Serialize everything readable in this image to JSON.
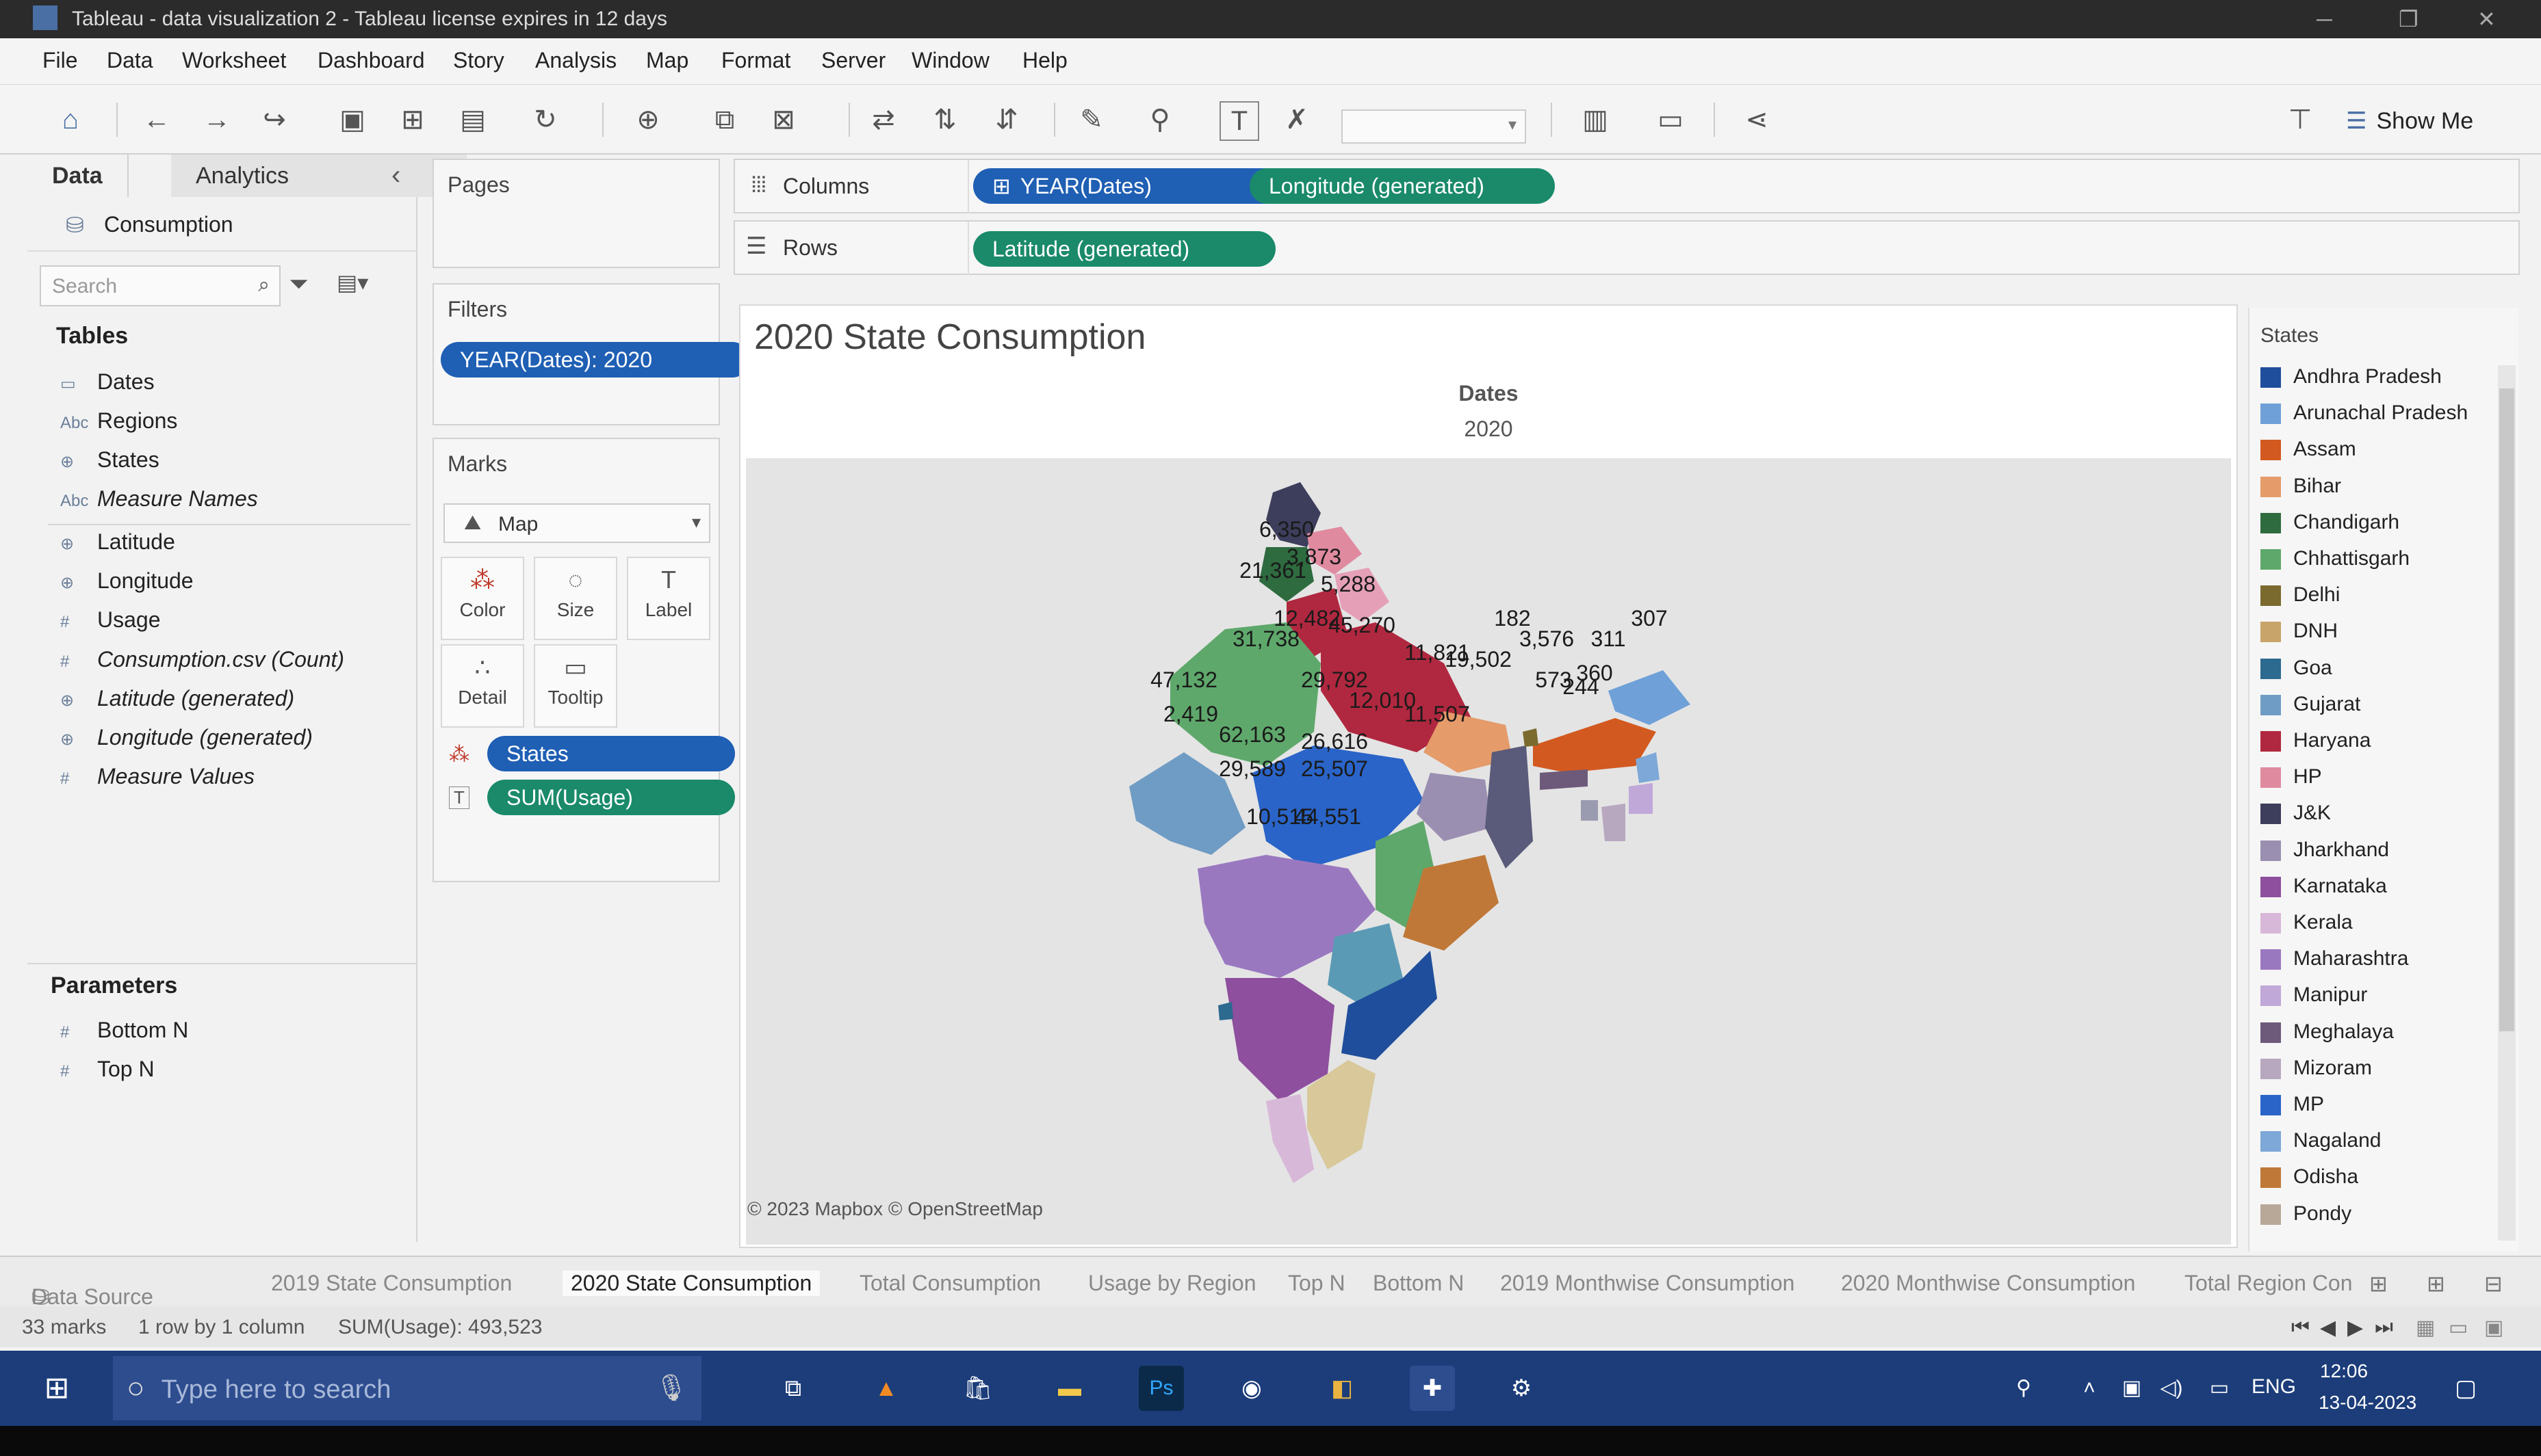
{
  "window": {
    "title": "Tableau - data visualization 2 - Tableau license expires in 12 days",
    "controls": {
      "minimize": "─",
      "restore": "❐",
      "close": "✕"
    }
  },
  "menu": [
    "File",
    "Data",
    "Worksheet",
    "Dashboard",
    "Story",
    "Analysis",
    "Map",
    "Format",
    "Server",
    "Window",
    "Help"
  ],
  "toolbar": {
    "show_me_label": "Show Me"
  },
  "left_panel": {
    "tabs": [
      "Data",
      "Analytics"
    ],
    "collapse_glyph": "‹",
    "datasource": "Consumption",
    "search_placeholder": "Search",
    "tables_heading": "Tables",
    "fields": [
      {
        "icon": "calendar-icon",
        "type": "▭",
        "label": "Dates",
        "italic": false
      },
      {
        "icon": "abc-icon",
        "type": "Abc",
        "label": "Regions",
        "italic": false
      },
      {
        "icon": "globe-icon",
        "type": "⊕",
        "label": "States",
        "italic": false
      },
      {
        "icon": "abc-icon",
        "type": "Abc",
        "label": "Measure Names",
        "italic": true
      },
      {
        "icon": "globe-icon",
        "type": "⊕",
        "label": "Latitude",
        "italic": false
      },
      {
        "icon": "globe-icon",
        "type": "⊕",
        "label": "Longitude",
        "italic": false
      },
      {
        "icon": "hash-icon",
        "type": "#",
        "label": "Usage",
        "italic": false
      },
      {
        "icon": "hash-icon",
        "type": "#",
        "label": "Consumption.csv (Count)",
        "italic": true
      },
      {
        "icon": "globe-icon",
        "type": "⊕",
        "label": "Latitude (generated)",
        "italic": true
      },
      {
        "icon": "globe-icon",
        "type": "⊕",
        "label": "Longitude (generated)",
        "italic": true
      },
      {
        "icon": "hash-icon",
        "type": "#",
        "label": "Measure Values",
        "italic": true
      }
    ],
    "parameters_heading": "Parameters",
    "parameters": [
      {
        "type": "#",
        "label": "Bottom N"
      },
      {
        "type": "#",
        "label": "Top N"
      }
    ]
  },
  "shelves": {
    "pages_label": "Pages",
    "filters_label": "Filters",
    "filter_pill": "YEAR(Dates): 2020",
    "marks_label": "Marks",
    "mark_type": "Map",
    "mark_buttons": [
      {
        "icon": "color-icon",
        "glyph": "⁂",
        "label": "Color"
      },
      {
        "icon": "size-icon",
        "glyph": "◌",
        "label": "Size"
      },
      {
        "icon": "label-icon",
        "glyph": "T",
        "label": "Label"
      },
      {
        "icon": "detail-icon",
        "glyph": "∴",
        "label": "Detail"
      },
      {
        "icon": "tooltip-icon",
        "glyph": "▭",
        "label": "Tooltip"
      }
    ],
    "mark_pills": [
      {
        "glyph": "⁂",
        "label": "States"
      },
      {
        "glyph": "T",
        "label": "SUM(Usage)"
      }
    ],
    "columns_label": "Columns",
    "columns_pills": [
      "YEAR(Dates)",
      "Longitude (generated)"
    ],
    "rows_label": "Rows",
    "rows_pills": [
      "Latitude (generated)"
    ]
  },
  "viz": {
    "title": "2020 State Consumption",
    "header_field": "Dates",
    "header_value": "2020",
    "attribution": "© 2023 Mapbox © OpenStreetMap",
    "map_labels": [
      {
        "text": "6,350"
      },
      {
        "text": "3,873"
      },
      {
        "text": "21,361"
      },
      {
        "text": "5,288"
      },
      {
        "text": "12,482"
      },
      {
        "text": "45,270"
      },
      {
        "text": "31,738"
      },
      {
        "text": "182"
      },
      {
        "text": "307"
      },
      {
        "text": "11,821"
      },
      {
        "text": "3,576"
      },
      {
        "text": "311"
      },
      {
        "text": "19,502"
      },
      {
        "text": "360"
      },
      {
        "text": "573"
      },
      {
        "text": "244"
      },
      {
        "text": "47,132"
      },
      {
        "text": "29,792"
      },
      {
        "text": "12,010"
      },
      {
        "text": "2,419"
      },
      {
        "text": "11,507"
      },
      {
        "text": "62,163"
      },
      {
        "text": "26,616"
      },
      {
        "text": "29,589"
      },
      {
        "text": "25,507"
      },
      {
        "text": "10,515"
      },
      {
        "text": "44,551"
      }
    ]
  },
  "legend": {
    "title": "States",
    "items": [
      {
        "label": "Andhra Pradesh",
        "color": "#1f4e9c"
      },
      {
        "label": "Arunachal Pradesh",
        "color": "#6fa0d8"
      },
      {
        "label": "Assam",
        "color": "#d2591f"
      },
      {
        "label": "Bihar",
        "color": "#e59b6a"
      },
      {
        "label": "Chandigarh",
        "color": "#2e6b3f"
      },
      {
        "label": "Chhattisgarh",
        "color": "#5ea86b"
      },
      {
        "label": "Delhi",
        "color": "#7a6a2e"
      },
      {
        "label": "DNH",
        "color": "#c9a46a"
      },
      {
        "label": "Goa",
        "color": "#2c6a8f"
      },
      {
        "label": "Gujarat",
        "color": "#6f9cc4"
      },
      {
        "label": "Haryana",
        "color": "#b0283f"
      },
      {
        "label": "HP",
        "color": "#e08aa0"
      },
      {
        "label": "J&K",
        "color": "#3d3d5c"
      },
      {
        "label": "Jharkhand",
        "color": "#9a8fb0"
      },
      {
        "label": "Karnataka",
        "color": "#8e4f9e"
      },
      {
        "label": "Kerala",
        "color": "#d8b8d8"
      },
      {
        "label": "Maharashtra",
        "color": "#9a78c0"
      },
      {
        "label": "Manipur",
        "color": "#c0a8d8"
      },
      {
        "label": "Meghalaya",
        "color": "#6d5a7a"
      },
      {
        "label": "Mizoram",
        "color": "#b7a8c0"
      },
      {
        "label": "MP",
        "color": "#2a64c8"
      },
      {
        "label": "Nagaland",
        "color": "#7da8d8"
      },
      {
        "label": "Odisha",
        "color": "#c07838"
      },
      {
        "label": "Pondy",
        "color": "#b8a898"
      }
    ]
  },
  "sheet_tabs": {
    "data_source": "Data Source",
    "tabs": [
      "2019 State Consumption",
      "2020 State Consumption",
      "Total Consumption",
      "Usage by Region",
      "Top N",
      "Bottom N",
      "2019 Monthwise Consumption",
      "2020 Monthwise Consumption",
      "Total Region Con"
    ],
    "active_index": 1
  },
  "status": {
    "marks": "33 marks",
    "rows_cols": "1 row by 1 column",
    "sum": "SUM(Usage): 493,523"
  },
  "taskbar": {
    "search_placeholder": "Type here to search",
    "language": "ENG",
    "time": "12:06",
    "date": "13-04-2023"
  }
}
